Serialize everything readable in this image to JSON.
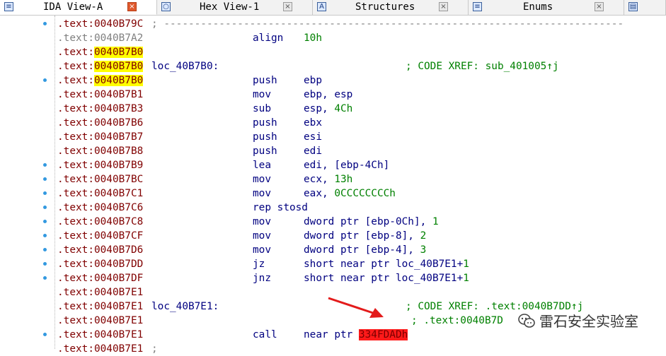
{
  "tabs": [
    {
      "icon": "ida-view-icon",
      "glyph": "≡",
      "label": "IDA View-A",
      "active": true
    },
    {
      "icon": "hex-view-icon",
      "glyph": "○",
      "label": "Hex View-1",
      "active": false
    },
    {
      "icon": "structures-icon",
      "glyph": "A",
      "label": "Structures",
      "active": false
    },
    {
      "icon": "enums-icon",
      "glyph": "≡",
      "label": "Enums",
      "active": false
    },
    {
      "icon": "imports-icon",
      "glyph": "▤",
      "label": "",
      "active": false
    }
  ],
  "close_glyph": "×",
  "lines": [
    {
      "seg": ".text:",
      "off": "0040B79C",
      "sep": "; ---------------------------------------------------------------------------",
      "bullet": true,
      "gray": false
    },
    {
      "seg": ".text:",
      "off": "0040B7A2",
      "mn": "align",
      "op": "10h",
      "opnum": true,
      "gray": true
    },
    {
      "seg": ".text:",
      "off": "0040B7B0",
      "hl": true
    },
    {
      "seg": ".text:",
      "off": "0040B7B0",
      "hl": true,
      "label": "loc_40B7B0:",
      "cmt": "; CODE XREF: sub_401005↑j",
      "cmtx": 573
    },
    {
      "seg": ".text:",
      "off": "0040B7B0",
      "hl": true,
      "bullet": true,
      "mn": "push",
      "op": "ebp"
    },
    {
      "seg": ".text:",
      "off": "0040B7B1",
      "mn": "mov",
      "op": "ebp, esp"
    },
    {
      "seg": ".text:",
      "off": "0040B7B3",
      "mn": "sub",
      "op_pre": "esp, ",
      "op_num": "4Ch"
    },
    {
      "seg": ".text:",
      "off": "0040B7B6",
      "mn": "push",
      "op": "ebx"
    },
    {
      "seg": ".text:",
      "off": "0040B7B7",
      "mn": "push",
      "op": "esi"
    },
    {
      "seg": ".text:",
      "off": "0040B7B8",
      "mn": "push",
      "op": "edi"
    },
    {
      "seg": ".text:",
      "off": "0040B7B9",
      "mn": "lea",
      "op": "edi, [ebp-4Ch]",
      "bullet": true
    },
    {
      "seg": ".text:",
      "off": "0040B7BC",
      "mn": "mov",
      "op_pre": "ecx, ",
      "op_num": "13h",
      "bullet": true
    },
    {
      "seg": ".text:",
      "off": "0040B7C1",
      "mn": "mov",
      "op_pre": "eax, ",
      "op_num": "0CCCCCCCCh",
      "bullet": true
    },
    {
      "seg": ".text:",
      "off": "0040B7C6",
      "mn": "rep stosd",
      "bullet": true
    },
    {
      "seg": ".text:",
      "off": "0040B7C8",
      "mn": "mov",
      "op_pre": "dword ptr [ebp-0Ch], ",
      "op_num": "1",
      "bullet": true
    },
    {
      "seg": ".text:",
      "off": "0040B7CF",
      "mn": "mov",
      "op_pre": "dword ptr [ebp-8], ",
      "op_num": "2",
      "bullet": true
    },
    {
      "seg": ".text:",
      "off": "0040B7D6",
      "mn": "mov",
      "op_pre": "dword ptr [ebp-4], ",
      "op_num": "3",
      "bullet": true
    },
    {
      "seg": ".text:",
      "off": "0040B7DD",
      "mn": "jz",
      "op_pre": "short near ptr loc_40B7E1+",
      "op_num": "1",
      "bullet": true
    },
    {
      "seg": ".text:",
      "off": "0040B7DF",
      "mn": "jnz",
      "op_pre": "short near ptr loc_40B7E1+",
      "op_num": "1",
      "bullet": true
    },
    {
      "seg": ".text:",
      "off": "0040B7E1"
    },
    {
      "seg": ".text:",
      "off": "0040B7E1",
      "label": "loc_40B7E1:",
      "cmt": "; CODE XREF: .text:0040B7DD↑j",
      "cmtx": 573
    },
    {
      "seg": ".text:",
      "off": "0040B7E1",
      "cmt": "; .text:0040B7D",
      "cmtx": 581
    },
    {
      "seg": ".text:",
      "off": "0040B7E1",
      "mn": "call",
      "op_pre": "near ptr ",
      "op_red": "334FDADh",
      "bullet": true
    },
    {
      "seg": ".text:",
      "off": "0040B7E1",
      "sep": ";"
    }
  ],
  "watermark": "雷石安全实验室",
  "colors": {
    "address": "#800000",
    "highlight": "#ffff00",
    "keyword": "#000080",
    "number": "#008000",
    "comment": "#008000",
    "bad_target": "#ff1a1a",
    "arrow": "#e31b1b"
  }
}
